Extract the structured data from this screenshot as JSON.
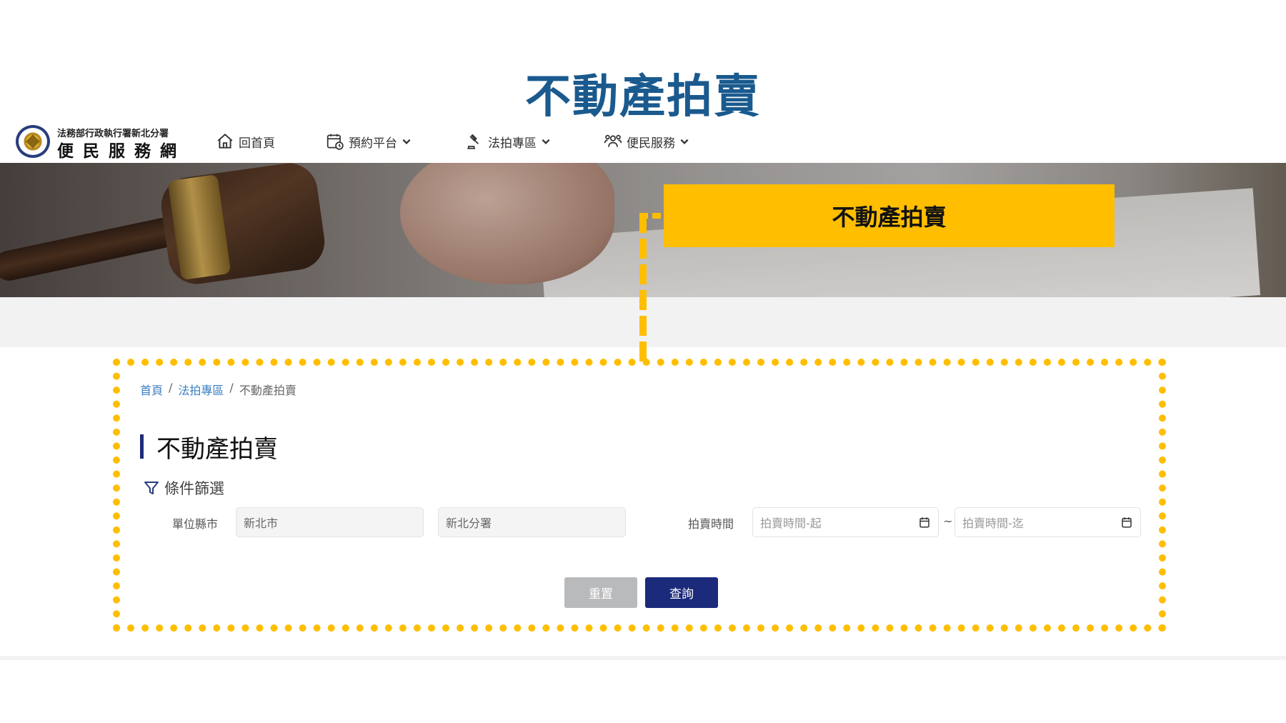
{
  "slide": {
    "title": "不動產拍賣"
  },
  "header": {
    "logo_top": "法務部行政執行署新北分署",
    "logo_main": "便民服務網",
    "nav": [
      {
        "label": "回首頁",
        "icon": "home-icon",
        "has_dropdown": false
      },
      {
        "label": "預約平台",
        "icon": "calendar-clock-icon",
        "has_dropdown": true
      },
      {
        "label": "法拍專區",
        "icon": "auction-hammer-icon",
        "has_dropdown": true
      },
      {
        "label": "便民服務",
        "icon": "people-icon",
        "has_dropdown": true
      }
    ]
  },
  "callout": {
    "label": "不動產拍賣",
    "color": "#ffbe00"
  },
  "breadcrumb": {
    "items": [
      "首頁",
      "法拍專區",
      "不動產拍賣"
    ],
    "separator": "/"
  },
  "page": {
    "heading": "不動產拍賣",
    "filter_title": "條件篩選"
  },
  "filters": {
    "unit_label": "單位縣市",
    "city_value": "新北市",
    "branch_value": "新北分署",
    "time_label": "拍賣時間",
    "time_start_placeholder": "拍賣時間-起",
    "time_end_placeholder": "拍賣時間-迄",
    "range_separator": "~"
  },
  "buttons": {
    "reset": "重置",
    "search": "查詢"
  },
  "colors": {
    "accent": "#1b2a7a",
    "title": "#1a5a8e",
    "link": "#3a7fc1"
  }
}
